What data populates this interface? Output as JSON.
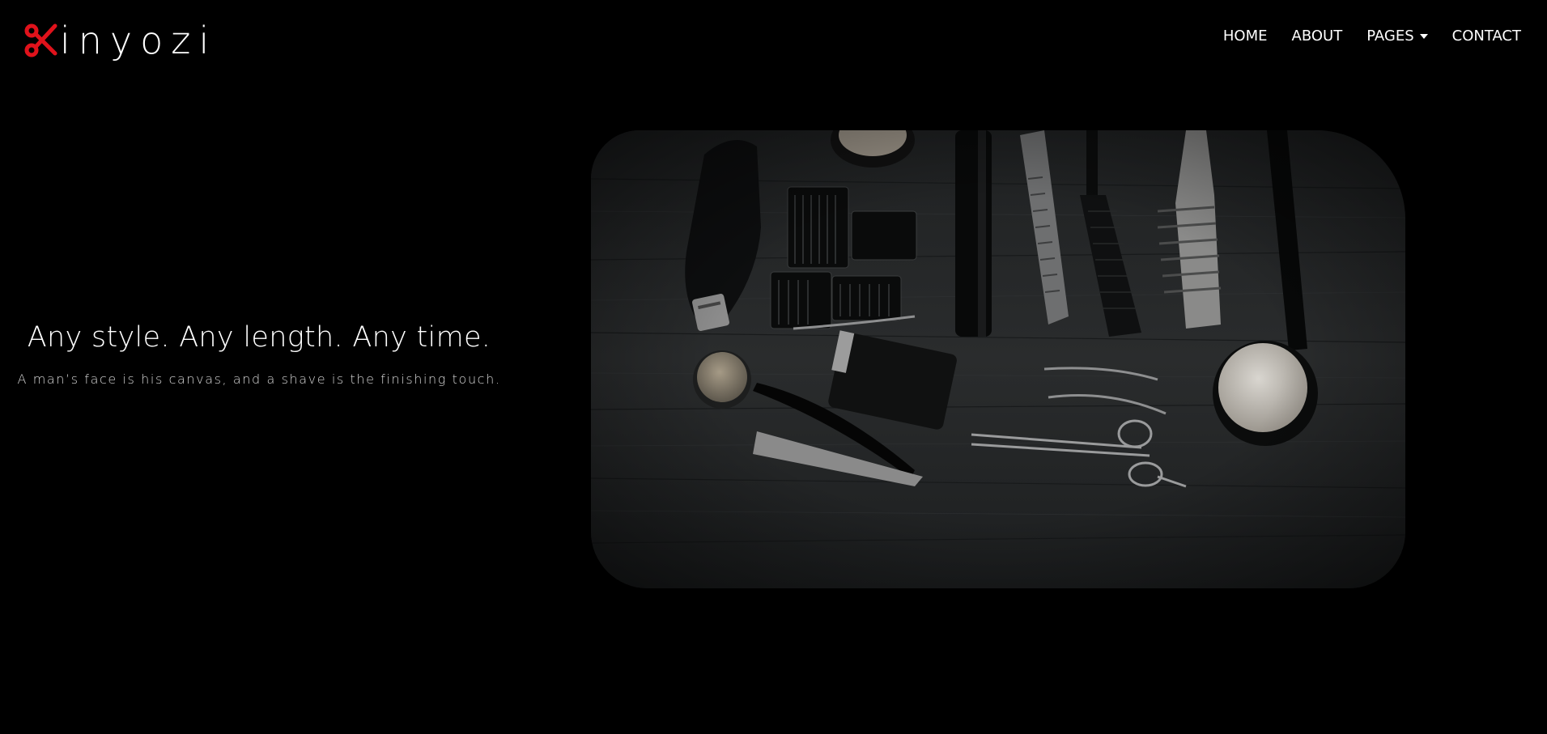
{
  "brand": {
    "name": "inyozi",
    "icon": "scissors-icon",
    "accent_color": "#e0121b"
  },
  "nav": {
    "items": [
      {
        "label": "HOME"
      },
      {
        "label": "ABOUT"
      },
      {
        "label": "PAGES",
        "dropdown": true
      },
      {
        "label": "CONTACT"
      }
    ]
  },
  "hero": {
    "title": "Any style. Any length. Any time.",
    "subtitle": "A man’s face is his canvas, and a shave is the finishing touch.",
    "image_icon": "barber-tools-image"
  }
}
